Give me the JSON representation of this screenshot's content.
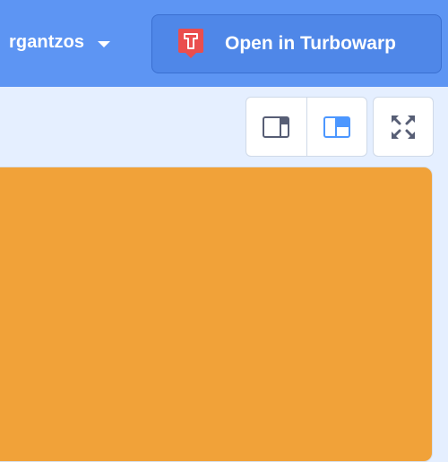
{
  "header": {
    "username": "rgantzos",
    "turbowarp_button_label": "Open in Turbowarp"
  },
  "controls": {
    "small_stage_icon": "small-stage-icon",
    "large_stage_icon": "large-stage-icon",
    "fullscreen_icon": "fullscreen-icon"
  },
  "colors": {
    "header_bg": "#5d95f3",
    "page_bg": "#e5efff",
    "stage_bg": "#f1a239",
    "turbowarp_logo": "#ea4e4e",
    "accent": "#4c97ff"
  }
}
